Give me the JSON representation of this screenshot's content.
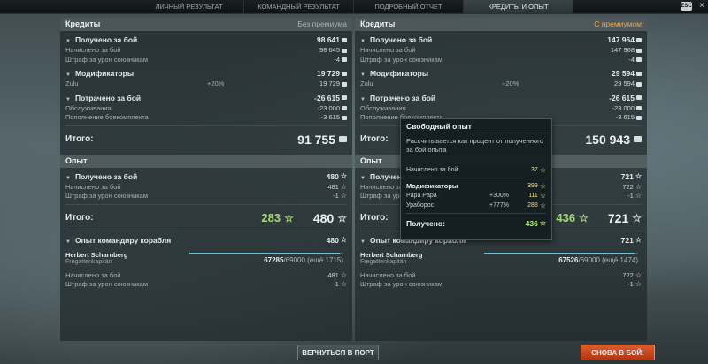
{
  "tabs": [
    "ЛИЧНЫЙ РЕЗУЛЬТАТ",
    "КОМАНДНЫЙ РЕЗУЛЬТАТ",
    "ПОДРОБНЫЙ ОТЧЁТ",
    "КРЕДИТЫ И ОПЫТ"
  ],
  "esc_label": "ESC",
  "close_glyph": "×",
  "left": {
    "credits_header": "Кредиты",
    "mode": "Без премиума",
    "received": {
      "label": "Получено за бой",
      "value": "98 641"
    },
    "received_rows": [
      {
        "label": "Начислено за бой",
        "mid": "",
        "value": "98 645"
      },
      {
        "label": "Штраф за урон союзникам",
        "mid": "",
        "value": "-4"
      }
    ],
    "modifiers": {
      "label": "Модификаторы",
      "value": "19 729"
    },
    "modifier_rows": [
      {
        "label": "Zulu",
        "mid": "+20%",
        "value": "19 729"
      }
    ],
    "spent": {
      "label": "Потрачено за бой",
      "value": "-26 615"
    },
    "spent_rows": [
      {
        "label": "Обслуживания",
        "mid": "",
        "value": "-23 000"
      },
      {
        "label": "Пополнение боекомплекта",
        "mid": "",
        "value": "-3 615"
      }
    ],
    "credits_total": {
      "label": "Итого:",
      "value": "91 755"
    },
    "xp_header": "Опыт",
    "xp_received": {
      "label": "Получено за бой",
      "value": "480"
    },
    "xp_rows": [
      {
        "label": "Начислено за бой",
        "mid": "",
        "value": "481"
      },
      {
        "label": "Штраф за урон союзникам",
        "mid": "",
        "value": "-1"
      }
    ],
    "xp_total": {
      "label": "Итого:",
      "free": "283",
      "value": "480"
    },
    "cmd": {
      "label": "Опыт командиру корабля",
      "value": "480"
    },
    "commander": {
      "name": "Herbert Scharnberg",
      "rank": "Fregattenkapitän",
      "current": "67285",
      "max": "69000",
      "remaining": "(ещё 1715)",
      "progress": 0.975
    },
    "cmd_rows": [
      {
        "label": "Начислено за бой",
        "mid": "",
        "value": "481"
      },
      {
        "label": "Штраф за урон союзникам",
        "mid": "",
        "value": "-1"
      }
    ]
  },
  "right": {
    "credits_header": "Кредиты",
    "mode": "С премиумом",
    "received": {
      "label": "Получено за бой",
      "value": "147 964"
    },
    "received_rows": [
      {
        "label": "Начислено за бой",
        "mid": "",
        "value": "147 968"
      },
      {
        "label": "Штраф за урон союзникам",
        "mid": "",
        "value": "-4"
      }
    ],
    "modifiers": {
      "label": "Модификаторы",
      "value": "29 594"
    },
    "modifier_rows": [
      {
        "label": "Zulu",
        "mid": "+20%",
        "value": "29 594"
      }
    ],
    "spent": {
      "label": "Потрачено за бой",
      "value": "-26 615"
    },
    "spent_rows": [
      {
        "label": "Обслуживания",
        "mid": "",
        "value": "-23 000"
      },
      {
        "label": "Пополнение боекомплекта",
        "mid": "",
        "value": "-3 615"
      }
    ],
    "credits_total": {
      "label": "Итого:",
      "value": "150 943"
    },
    "xp_header": "Опыт",
    "xp_received": {
      "label": "Получено за бой",
      "value": "721"
    },
    "xp_rows": [
      {
        "label": "Начислено за бой",
        "mid": "",
        "value": "722"
      },
      {
        "label": "Штраф за урон союзникам",
        "mid": "",
        "value": "-1"
      }
    ],
    "xp_total": {
      "label": "Итого:",
      "free": "436",
      "value": "721"
    },
    "cmd": {
      "label": "Опыт командиру корабля",
      "value": "721"
    },
    "commander": {
      "name": "Herbert Scharnberg",
      "rank": "Fregattenkapitän",
      "current": "67526",
      "max": "69000",
      "remaining": "(ещё 1474)",
      "progress": 0.979
    },
    "cmd_rows": [
      {
        "label": "Начислено за бой",
        "mid": "",
        "value": "722"
      },
      {
        "label": "Штраф за урон союзникам",
        "mid": "",
        "value": "-1"
      }
    ]
  },
  "tooltip": {
    "title": "Свободный опыт",
    "description": "Рассчитывается как процент от полученного за бой опыта",
    "base_label": "Начислено за бой",
    "base_value": "37",
    "modifiers_label": "Модификаторы",
    "modifiers_value": "399",
    "rows": [
      {
        "label": "Papa Papa",
        "mid": "+300%",
        "value": "111"
      },
      {
        "label": "Ураборос",
        "mid": "+777%",
        "value": "288"
      }
    ],
    "total_label": "Получено:",
    "total_value": "436"
  },
  "buttons": {
    "port": "ВЕРНУТЬСЯ В ПОРТ",
    "battle": "СНОВА В БОЙ!"
  },
  "colors": {
    "premium": "#f0a640",
    "free_xp": "#a6d77e",
    "battle_button": "#d24a1e",
    "progress": "#6ec2d6"
  }
}
